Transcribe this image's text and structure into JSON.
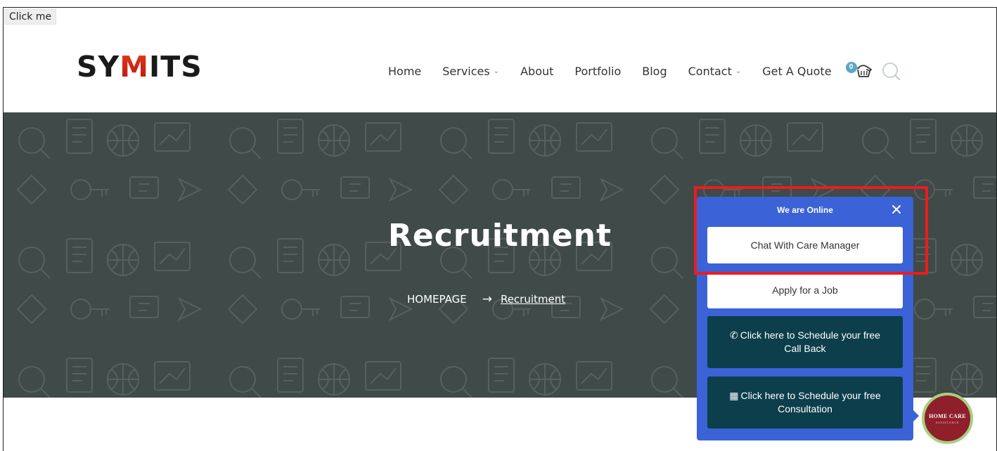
{
  "debug": {
    "click_me_label": "Click me"
  },
  "brand": {
    "logo_prefix": "SY",
    "logo_m": "M",
    "logo_suffix": "ITS",
    "accent_color": "#d32a1a"
  },
  "nav": {
    "items": [
      {
        "label": "Home",
        "has_dropdown": false
      },
      {
        "label": "Services",
        "has_dropdown": true
      },
      {
        "label": "About",
        "has_dropdown": false
      },
      {
        "label": "Portfolio",
        "has_dropdown": false
      },
      {
        "label": "Blog",
        "has_dropdown": false
      },
      {
        "label": "Contact",
        "has_dropdown": true
      },
      {
        "label": "Get A Quote",
        "has_dropdown": false
      }
    ],
    "cart_count": "0",
    "cart_icon": "cart-icon",
    "search_icon": "search-icon"
  },
  "hero": {
    "title": "Recruitment",
    "breadcrumb": {
      "home": "HOMEPAGE",
      "separator": "→",
      "current": "Recruitment"
    },
    "background_color": "#3f4a49"
  },
  "chat_widget": {
    "status": "We are Online",
    "close_icon": "close-icon",
    "buttons": [
      {
        "label": "Chat With Care Manager",
        "style": "light"
      },
      {
        "label": "Apply for a Job",
        "style": "light"
      },
      {
        "icon": "phone-icon",
        "line1": "Click here to Schedule your free",
        "line2": "Call Back",
        "style": "dark"
      },
      {
        "icon": "calendar-icon",
        "line1": "Click here to Schedule your free",
        "line2": "Consultation",
        "style": "dark"
      }
    ],
    "panel_color": "#3b62d6",
    "dark_button_color": "#0c3f4b"
  },
  "launcher": {
    "main_text": "HOME CARE",
    "sub_text": "ASSISTANCE",
    "color": "#8e1f2b"
  },
  "highlight": {
    "color": "#ee1c1c"
  }
}
